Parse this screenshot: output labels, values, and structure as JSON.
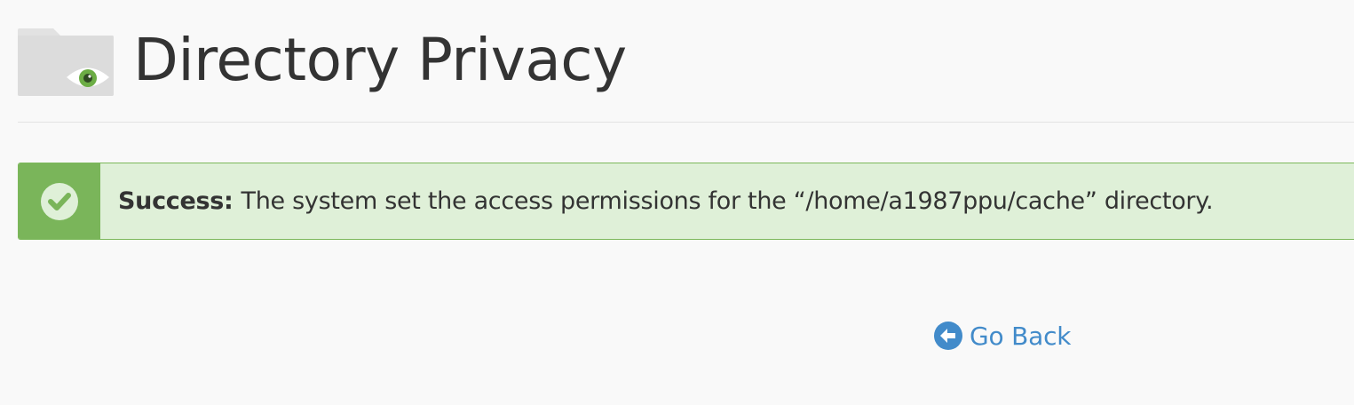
{
  "header": {
    "title": "Directory Privacy",
    "icon": "folder-eye-icon"
  },
  "alert": {
    "type": "success",
    "icon": "check-circle-icon",
    "label": "Success:",
    "message": "The system set the access permissions for the “/home/a1987ppu/cache” directory.",
    "colors": {
      "icon_background": "#7ab55a",
      "background": "#dff0d8",
      "border": "#7cb85b"
    }
  },
  "actions": {
    "go_back_label": "Go Back",
    "go_back_icon": "arrow-circle-left-icon",
    "link_color": "#428bca"
  }
}
